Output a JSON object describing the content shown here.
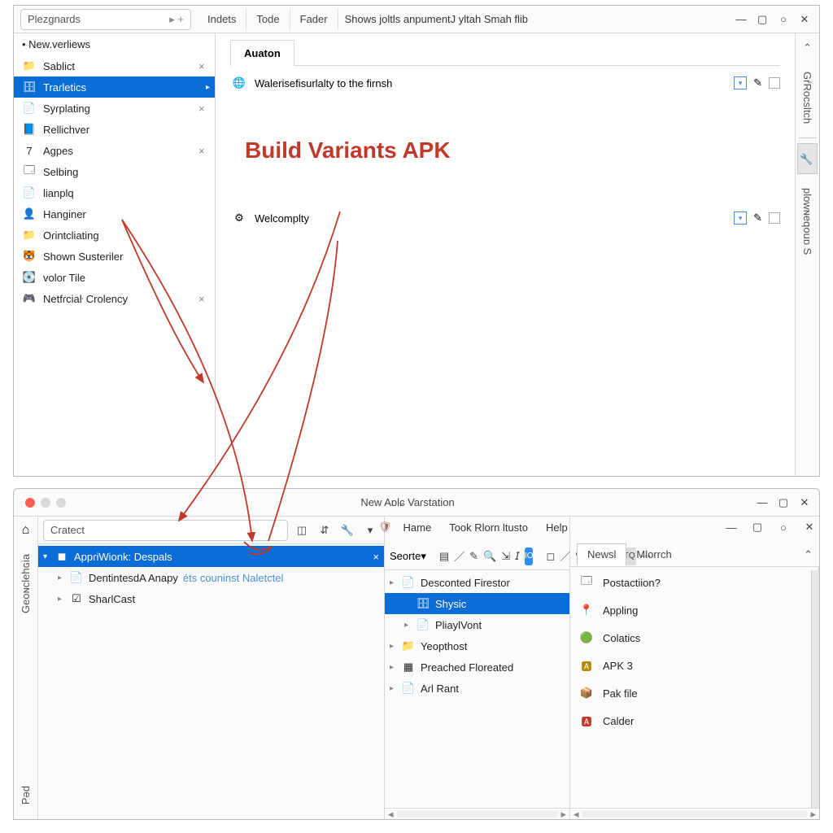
{
  "top": {
    "project_input": "Plezgnards",
    "menu_tabs": [
      "Indets",
      "Tode",
      "Fader"
    ],
    "menu_text": "Shows joltls  anpumentJ yltah Smah flib",
    "side_header": "New.verliews",
    "side_items": [
      {
        "label": "Sablict",
        "closable": true,
        "icon": "folder-blue"
      },
      {
        "label": "Traɾletics",
        "selected": true,
        "submenu": true,
        "icon": "db"
      },
      {
        "label": "Syɾplating",
        "closable": true,
        "icon": "doc"
      },
      {
        "label": "Rellichver",
        "icon": "doc-blue"
      },
      {
        "label": "Agpes",
        "closable": true,
        "icon": "seven"
      },
      {
        "label": "Selbing",
        "icon": "window"
      },
      {
        "label": "lianplq",
        "icon": "doc"
      },
      {
        "label": "Hanginer",
        "icon": "person"
      },
      {
        "label": "Oɾintcliating",
        "icon": "folder-blue"
      },
      {
        "label": "Shown Susteriler",
        "icon": "tiger"
      },
      {
        "label": "volor Tile",
        "icon": "drive"
      },
      {
        "label": "Netfɾciaŀ Crolency",
        "closable": true,
        "icon": "console"
      }
    ],
    "main_tab": "Auaton",
    "row1": "Walerisefisurlalty to the firnsh",
    "row2": "Welcomplty",
    "heading": "Build Variants APK",
    "right_tabs": [
      "GŕRocsltch",
      "plowɴeqouɒ S"
    ],
    "right_active_icon": "wrench"
  },
  "bottom": {
    "title": "New Aɒlɕ Vaɾstation",
    "left_vtabs": [
      "Geoɴclehɢia",
      "Pəd"
    ],
    "search": "Cratect",
    "inner_menu": [
      "Hame",
      "Took Rlorn ltusto",
      "Help"
    ],
    "segment": "Seorte",
    "search_badge": "FTQ",
    "left_tree": [
      {
        "label": "AppɾiWionk: Despals",
        "sel": true,
        "level": 0,
        "icon": "square",
        "close": true,
        "exp": "▾"
      },
      {
        "label": "DentintesdA Anapy",
        "suffix": "éts couninst Naletctel",
        "level": 1,
        "icon": "page",
        "exp": "▸"
      },
      {
        "label": "ShaɾlCast",
        "level": 1,
        "icon": "check",
        "exp": "▸"
      }
    ],
    "mid_tree": [
      {
        "label": "Desconted Firestor",
        "level": 0,
        "icon": "page",
        "exp": "▸"
      },
      {
        "label": "Shysic",
        "sel": true,
        "level": 1,
        "icon": "db"
      },
      {
        "label": "PliaylVont",
        "level": 1,
        "icon": "page",
        "exp": "▸"
      },
      {
        "label": "Yeopthost",
        "level": 0,
        "icon": "folder-blue",
        "exp": "▸"
      },
      {
        "label": "Preached Floreated",
        "level": 0,
        "icon": "grid",
        "exp": "▸"
      },
      {
        "label": "Aɾl Rant",
        "level": 0,
        "icon": "page",
        "exp": "▸"
      }
    ],
    "right_tabs": [
      "Newsl",
      "Mlorrch"
    ],
    "panel_items": [
      {
        "label": "Postactiion?",
        "icon": "window-b"
      },
      {
        "label": "Appling",
        "icon": "pin"
      },
      {
        "label": "Colatics",
        "icon": "green"
      },
      {
        "label": "APK 3",
        "icon": "ai"
      },
      {
        "label": "Pak file",
        "icon": "box"
      },
      {
        "label": "Calder",
        "icon": "red-a"
      }
    ]
  }
}
